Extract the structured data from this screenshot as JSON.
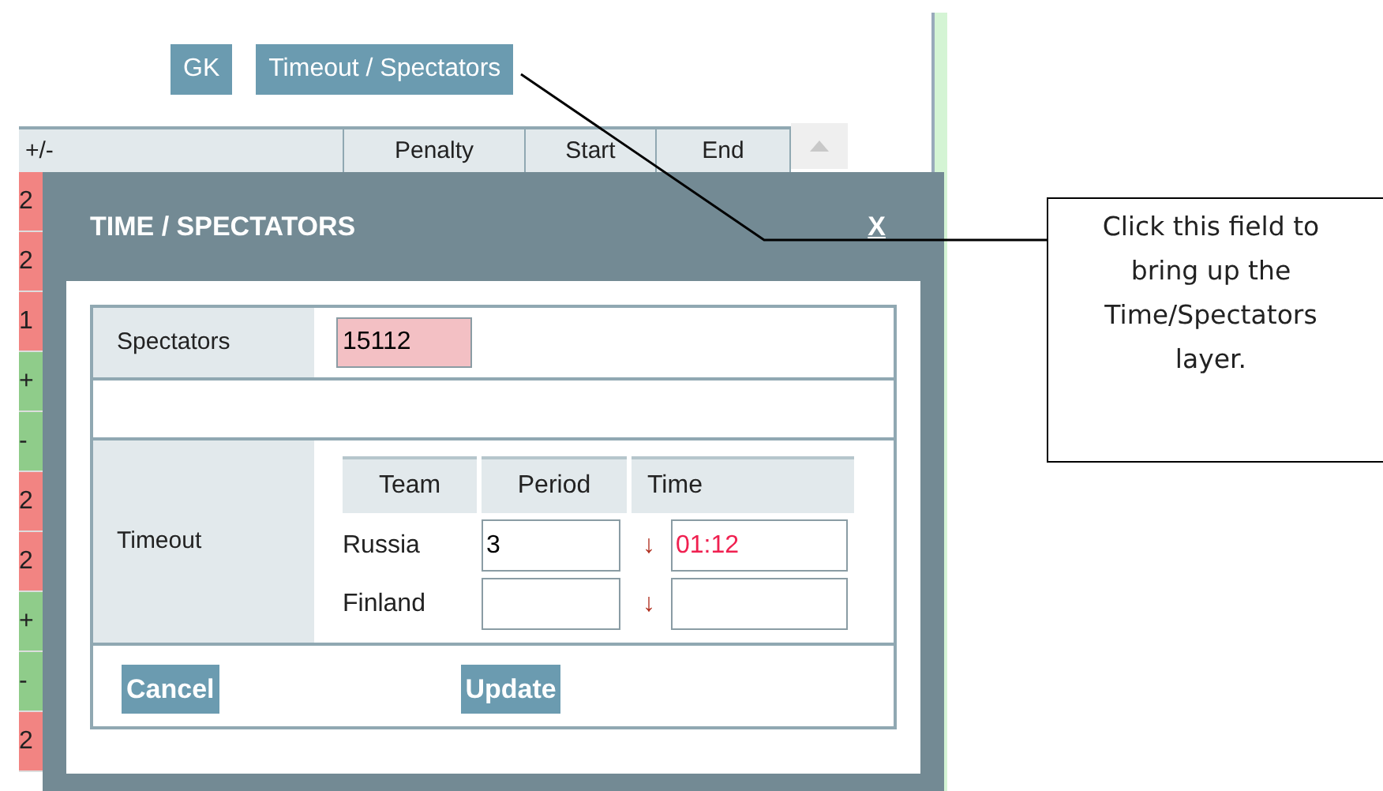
{
  "toolbar": {
    "buttons": [
      {
        "label": "GK"
      },
      {
        "label": "Timeout / Spectators"
      }
    ]
  },
  "table": {
    "columns": [
      "+/-",
      "Penalty",
      "Start",
      "End"
    ],
    "rows": [
      {
        "value": "2",
        "color": "#f28482"
      },
      {
        "value": "2",
        "color": "#f28482"
      },
      {
        "value": "1",
        "color": "#f28482"
      },
      {
        "value": "+",
        "color": "#8fcc8a"
      },
      {
        "value": "-",
        "color": "#8fcc8a"
      },
      {
        "value": "2",
        "color": "#f28482"
      },
      {
        "value": "2",
        "color": "#f28482"
      },
      {
        "value": "+",
        "color": "#8fcc8a"
      },
      {
        "value": "-",
        "color": "#8fcc8a"
      },
      {
        "value": "2",
        "color": "#f28482"
      }
    ]
  },
  "dialog": {
    "title": "TIME / SPECTATORS",
    "close": "X",
    "spectators": {
      "label": "Spectators",
      "value": "15112"
    },
    "timeout": {
      "label": "Timeout",
      "columns": [
        "Team",
        "Period",
        "Time"
      ],
      "rows": [
        {
          "team": "Russia",
          "period": "3",
          "arrow": "↓",
          "time": "01:12"
        },
        {
          "team": "Finland",
          "period": "",
          "arrow": "↓",
          "time": ""
        }
      ]
    },
    "buttons": [
      {
        "label": "Cancel"
      },
      {
        "label": "Update"
      }
    ]
  },
  "callout": {
    "text": "Click this field to bring up the Time/Spectators layer."
  }
}
